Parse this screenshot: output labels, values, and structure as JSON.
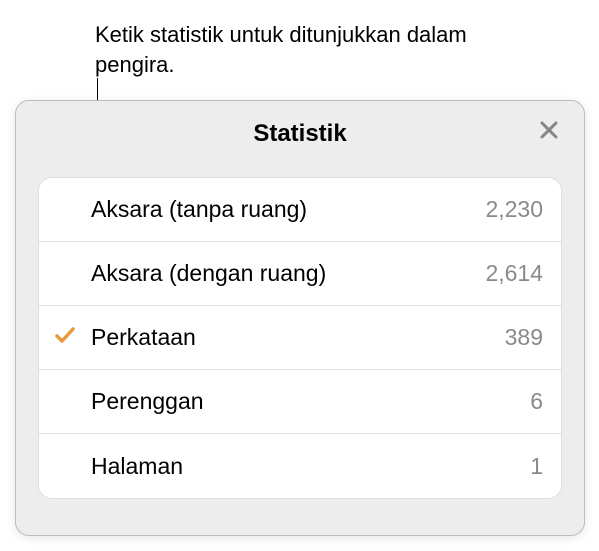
{
  "annotation": "Ketik statistik untuk ditunjukkan dalam pengira.",
  "panel": {
    "title": "Statistik"
  },
  "stats": [
    {
      "label": "Aksara (tanpa ruang)",
      "value": "2,230",
      "selected": false
    },
    {
      "label": "Aksara (dengan ruang)",
      "value": "2,614",
      "selected": false
    },
    {
      "label": "Perkataan",
      "value": "389",
      "selected": true
    },
    {
      "label": "Perenggan",
      "value": "6",
      "selected": false
    },
    {
      "label": "Halaman",
      "value": "1",
      "selected": false
    }
  ],
  "colors": {
    "accent": "#e89b3e",
    "closeIcon": "#86868a"
  }
}
